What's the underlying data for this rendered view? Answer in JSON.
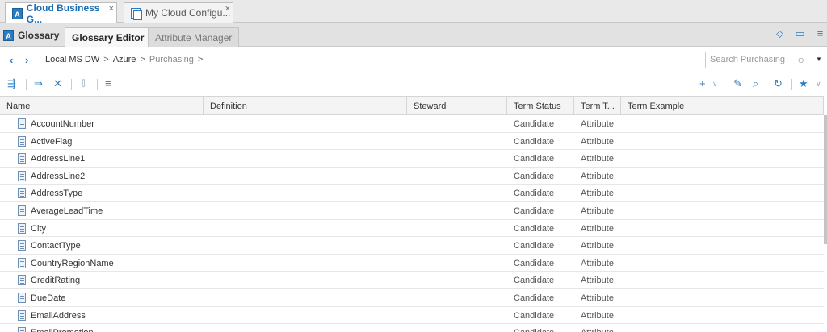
{
  "doc_tabs": [
    {
      "label": "Cloud Business G...",
      "close": "×"
    },
    {
      "label": "My Cloud Configu...",
      "close": "×"
    }
  ],
  "sub_tabs": {
    "glossary": "Glossary",
    "editor": "Glossary Editor",
    "attribute_manager": "Attribute Manager"
  },
  "breadcrumb": {
    "items": [
      "Local MS DW",
      "Azure",
      "Purchasing"
    ],
    "separator": ">"
  },
  "search": {
    "placeholder": "Search Purchasing"
  },
  "grid": {
    "columns": [
      "Name",
      "Definition",
      "Steward",
      "Term Status",
      "Term T...",
      "Term Example"
    ],
    "rows": [
      {
        "name": "AccountNumber",
        "status": "Candidate",
        "type": "Attribute"
      },
      {
        "name": "ActiveFlag",
        "status": "Candidate",
        "type": "Attribute"
      },
      {
        "name": "AddressLine1",
        "status": "Candidate",
        "type": "Attribute"
      },
      {
        "name": "AddressLine2",
        "status": "Candidate",
        "type": "Attribute"
      },
      {
        "name": "AddressType",
        "status": "Candidate",
        "type": "Attribute"
      },
      {
        "name": "AverageLeadTime",
        "status": "Candidate",
        "type": "Attribute"
      },
      {
        "name": "City",
        "status": "Candidate",
        "type": "Attribute"
      },
      {
        "name": "ContactType",
        "status": "Candidate",
        "type": "Attribute"
      },
      {
        "name": "CountryRegionName",
        "status": "Candidate",
        "type": "Attribute"
      },
      {
        "name": "CreditRating",
        "status": "Candidate",
        "type": "Attribute"
      },
      {
        "name": "DueDate",
        "status": "Candidate",
        "type": "Attribute"
      },
      {
        "name": "EmailAddress",
        "status": "Candidate",
        "type": "Attribute"
      },
      {
        "name": "EmailPromotion",
        "status": "Candidate",
        "type": "Attribute"
      }
    ]
  },
  "colors": {
    "accent": "#2a7bc2"
  }
}
